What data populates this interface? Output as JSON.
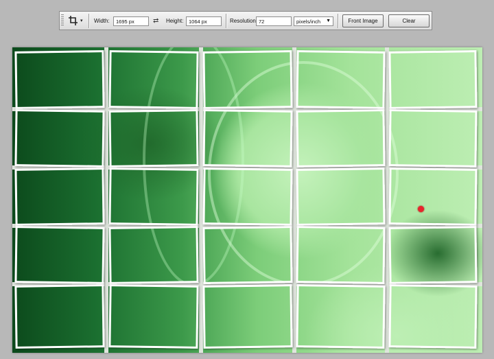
{
  "toolbar": {
    "tool_icon": "crop-icon",
    "width_label": "Width:",
    "width_value": "1695 px",
    "swap_icon": "swap-arrows-icon",
    "height_label": "Height:",
    "height_value": "1064 px",
    "resolution_label": "Resolution:",
    "resolution_value": "72",
    "resolution_unit": "pixels/inch",
    "front_image_label": "Front Image",
    "clear_label": "Clear"
  },
  "canvas": {
    "tile_rows": 5,
    "tile_cols": 5,
    "palette": {
      "dark": "#0d4f1e",
      "mid": "#3e9b4b",
      "light": "#a5e49b",
      "tile_border": "#ffffff",
      "background": "#b8b8b8"
    }
  }
}
